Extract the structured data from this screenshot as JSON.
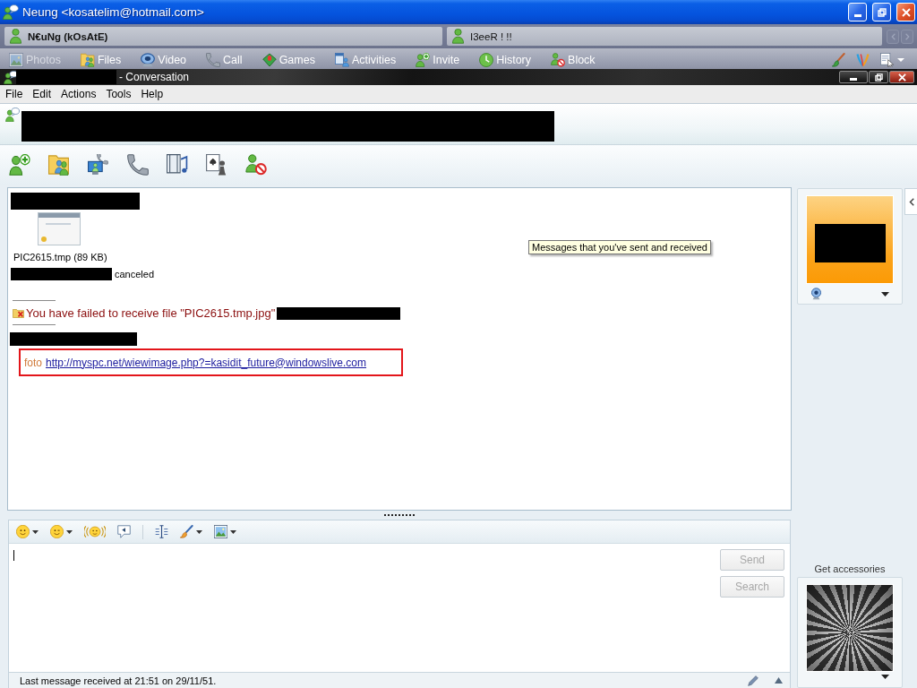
{
  "window": {
    "title": "Neung <kosatelim@hotmail.com>"
  },
  "tabs": [
    {
      "label": "N€uNg (kOsAtE)",
      "selected": true
    },
    {
      "label": "I3eeR ! !!",
      "selected": false
    }
  ],
  "toolbar": [
    {
      "label": "Photos",
      "disabled": true
    },
    {
      "label": "Files",
      "disabled": false
    },
    {
      "label": "Video",
      "disabled": false
    },
    {
      "label": "Call",
      "disabled": false
    },
    {
      "label": "Games",
      "disabled": false
    },
    {
      "label": "Activities",
      "disabled": false
    },
    {
      "label": "Invite",
      "disabled": false
    },
    {
      "label": "History",
      "disabled": false
    },
    {
      "label": "Block",
      "disabled": false
    }
  ],
  "conversation": {
    "title": "- Conversation",
    "menu": [
      "File",
      "Edit",
      "Actions",
      "Tools",
      "Help"
    ]
  },
  "messages": [
    {
      "kind": "sender"
    },
    {
      "kind": "file",
      "caption": "PIC2615.tmp (89 KB)"
    },
    {
      "kind": "status",
      "text": "canceled"
    },
    {
      "kind": "error",
      "text": "You have failed to receive file \"PIC2615.tmp.jpg\""
    },
    {
      "kind": "sender"
    },
    {
      "kind": "link",
      "text": "foto",
      "url": "http://myspc.net/wiewimage.php?=kasidit_future@windowslive.com",
      "highlighted": true
    }
  ],
  "tooltip": "Messages that you've sent and received",
  "compose": {
    "buttons": [
      {
        "label": "Send",
        "disabled": true
      },
      {
        "label": "Search",
        "disabled": true
      }
    ]
  },
  "sidebar": {
    "accessories_link": "Get accessories"
  },
  "status_bar": "Last message received at 21:51 on 29/11/51."
}
